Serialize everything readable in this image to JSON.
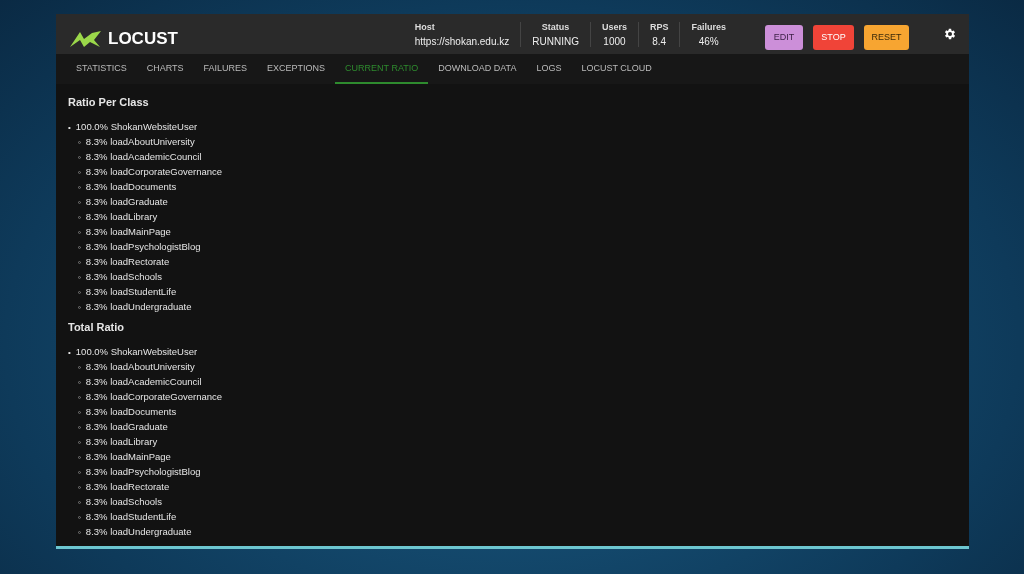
{
  "app": {
    "logo_text": "LOCUST"
  },
  "stats": [
    {
      "label": "Host",
      "value": "https://shokan.edu.kz"
    },
    {
      "label": "Status",
      "value": "RUNNING"
    },
    {
      "label": "Users",
      "value": "1000"
    },
    {
      "label": "RPS",
      "value": "8.4"
    },
    {
      "label": "Failures",
      "value": "46%"
    }
  ],
  "buttons": [
    {
      "label": "EDIT",
      "kind": "edit"
    },
    {
      "label": "STOP",
      "kind": "stop"
    },
    {
      "label": "RESET",
      "kind": "reset"
    }
  ],
  "tabs": [
    {
      "label": "STATISTICS",
      "selected": false
    },
    {
      "label": "CHARTS",
      "selected": false
    },
    {
      "label": "FAILURES",
      "selected": false
    },
    {
      "label": "EXCEPTIONS",
      "selected": false
    },
    {
      "label": "CURRENT RATIO",
      "selected": true
    },
    {
      "label": "DOWNLOAD DATA",
      "selected": false
    },
    {
      "label": "LOGS",
      "selected": false
    },
    {
      "label": "LOCUST CLOUD",
      "selected": false
    }
  ],
  "sections": [
    {
      "title": "Ratio Per Class",
      "items": [
        {
          "marker": "•",
          "text": "100.0% ShokanWebsiteUser",
          "child_marker": "◦",
          "children": [
            {
              "text": "8.3% loadAboutUniversity"
            },
            {
              "text": "8.3% loadAcademicCouncil"
            },
            {
              "text": "8.3% loadCorporateGovernance"
            },
            {
              "text": "8.3% loadDocuments"
            },
            {
              "text": "8.3% loadGraduate"
            },
            {
              "text": "8.3% loadLibrary"
            },
            {
              "text": "8.3% loadMainPage"
            },
            {
              "text": "8.3% loadPsychologistBlog"
            },
            {
              "text": "8.3% loadRectorate"
            },
            {
              "text": "8.3% loadSchools"
            },
            {
              "text": "8.3% loadStudentLife"
            },
            {
              "text": "8.3% loadUndergraduate"
            }
          ]
        }
      ]
    },
    {
      "title": "Total Ratio",
      "items": [
        {
          "marker": "•",
          "text": "100.0% ShokanWebsiteUser",
          "child_marker": "◦",
          "children": [
            {
              "text": "8.3% loadAboutUniversity"
            },
            {
              "text": "8.3% loadAcademicCouncil"
            },
            {
              "text": "8.3% loadCorporateGovernance"
            },
            {
              "text": "8.3% loadDocuments"
            },
            {
              "text": "8.3% loadGraduate"
            },
            {
              "text": "8.3% loadLibrary"
            },
            {
              "text": "8.3% loadMainPage"
            },
            {
              "text": "8.3% loadPsychologistBlog"
            },
            {
              "text": "8.3% loadRectorate"
            },
            {
              "text": "8.3% loadSchools"
            },
            {
              "text": "8.3% loadStudentLife"
            },
            {
              "text": "8.3% loadUndergraduate"
            }
          ]
        }
      ]
    }
  ]
}
